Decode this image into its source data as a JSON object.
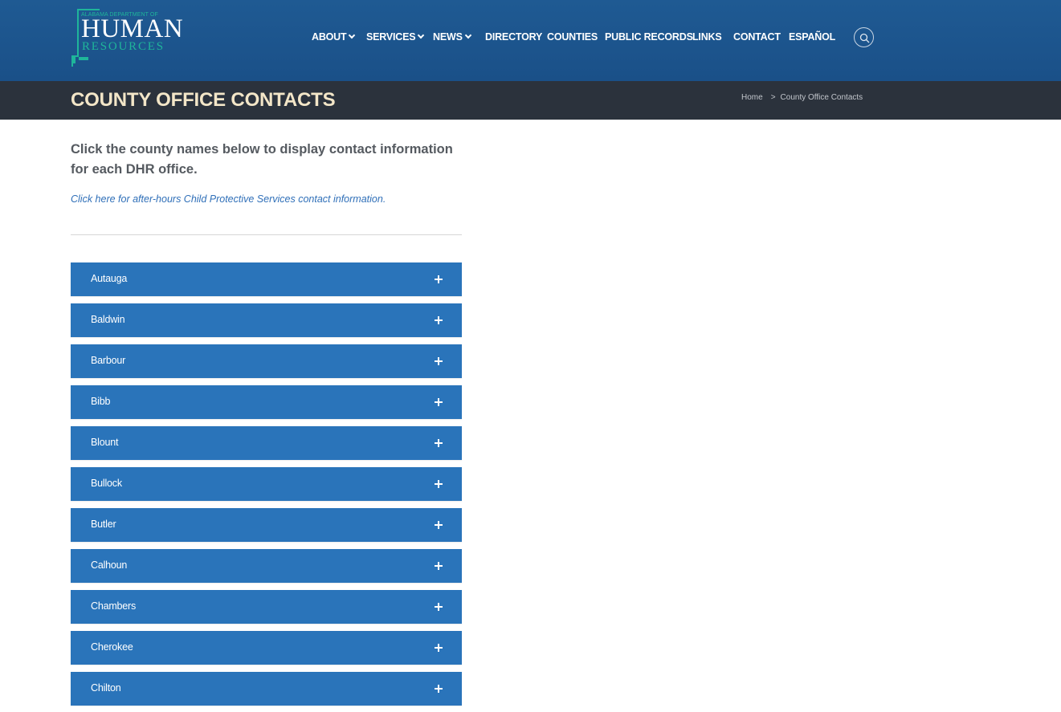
{
  "logo": {
    "top_text": "ALABAMA DEPARTMENT OF",
    "main_text": "HUMAN",
    "sub_text": "RESOURCES"
  },
  "nav": {
    "items": [
      {
        "label": "ABOUT",
        "has_dropdown": true
      },
      {
        "label": "SERVICES",
        "has_dropdown": true
      },
      {
        "label": "NEWS",
        "has_dropdown": true
      },
      {
        "label": "DIRECTORY",
        "has_dropdown": false
      },
      {
        "label": "COUNTIES",
        "has_dropdown": false
      },
      {
        "label": "PUBLIC RECORDS",
        "has_dropdown": false
      },
      {
        "label": "LINKS",
        "has_dropdown": false
      },
      {
        "label": "CONTACT",
        "has_dropdown": false
      },
      {
        "label": "ESPAÑOL",
        "has_dropdown": false
      }
    ],
    "search_icon": "search-icon"
  },
  "titlebar": {
    "title": "COUNTY OFFICE CONTACTS",
    "breadcrumb": {
      "home": "Home",
      "separator": ">",
      "current": "County Office Contacts"
    }
  },
  "content": {
    "intro": "Click the county names below to display contact information for each DHR office.",
    "after_hours_link": "Click here for after-hours Child Protective Services contact information."
  },
  "counties": [
    "Autauga",
    "Baldwin",
    "Barbour",
    "Bibb",
    "Blount",
    "Bullock",
    "Butler",
    "Calhoun",
    "Chambers",
    "Cherokee",
    "Chilton"
  ],
  "colors": {
    "header_bg": "#1f5a93",
    "titlebar_bg": "#2b323c",
    "title_text": "#f3e6c8",
    "accordion_bg": "#2a74ba",
    "link": "#2f6fb8",
    "logo_accent": "#1fb59a"
  }
}
